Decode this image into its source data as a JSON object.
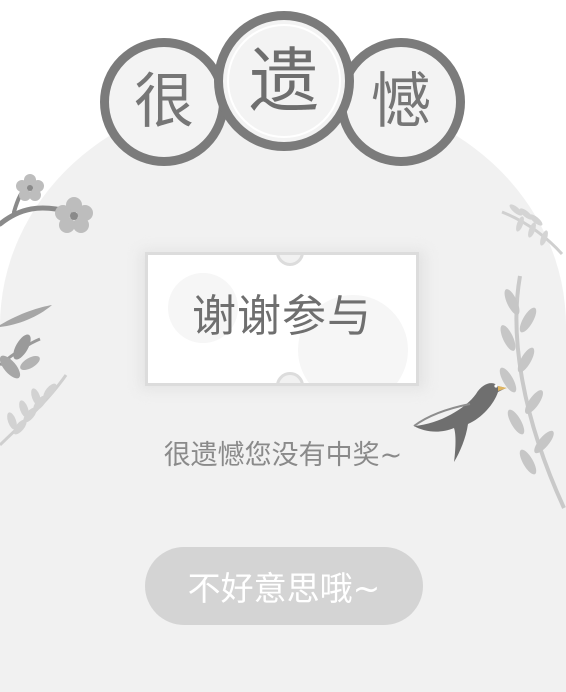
{
  "title": {
    "chars": [
      "很",
      "遗",
      "憾"
    ]
  },
  "ticket": {
    "text": "谢谢参与"
  },
  "message": "很遗憾您没有中奖~",
  "action_button": {
    "label": "不好意思哦~"
  },
  "colors": {
    "background": "#ffffff",
    "card": "#f1f1f1",
    "circle_border": "#7b7b7b",
    "text_primary": "#6f6f6f",
    "text_secondary": "#8a8a8a",
    "button_bg": "#d4d4d4",
    "button_text": "#ffffff",
    "bird_beak": "#e0b560"
  }
}
